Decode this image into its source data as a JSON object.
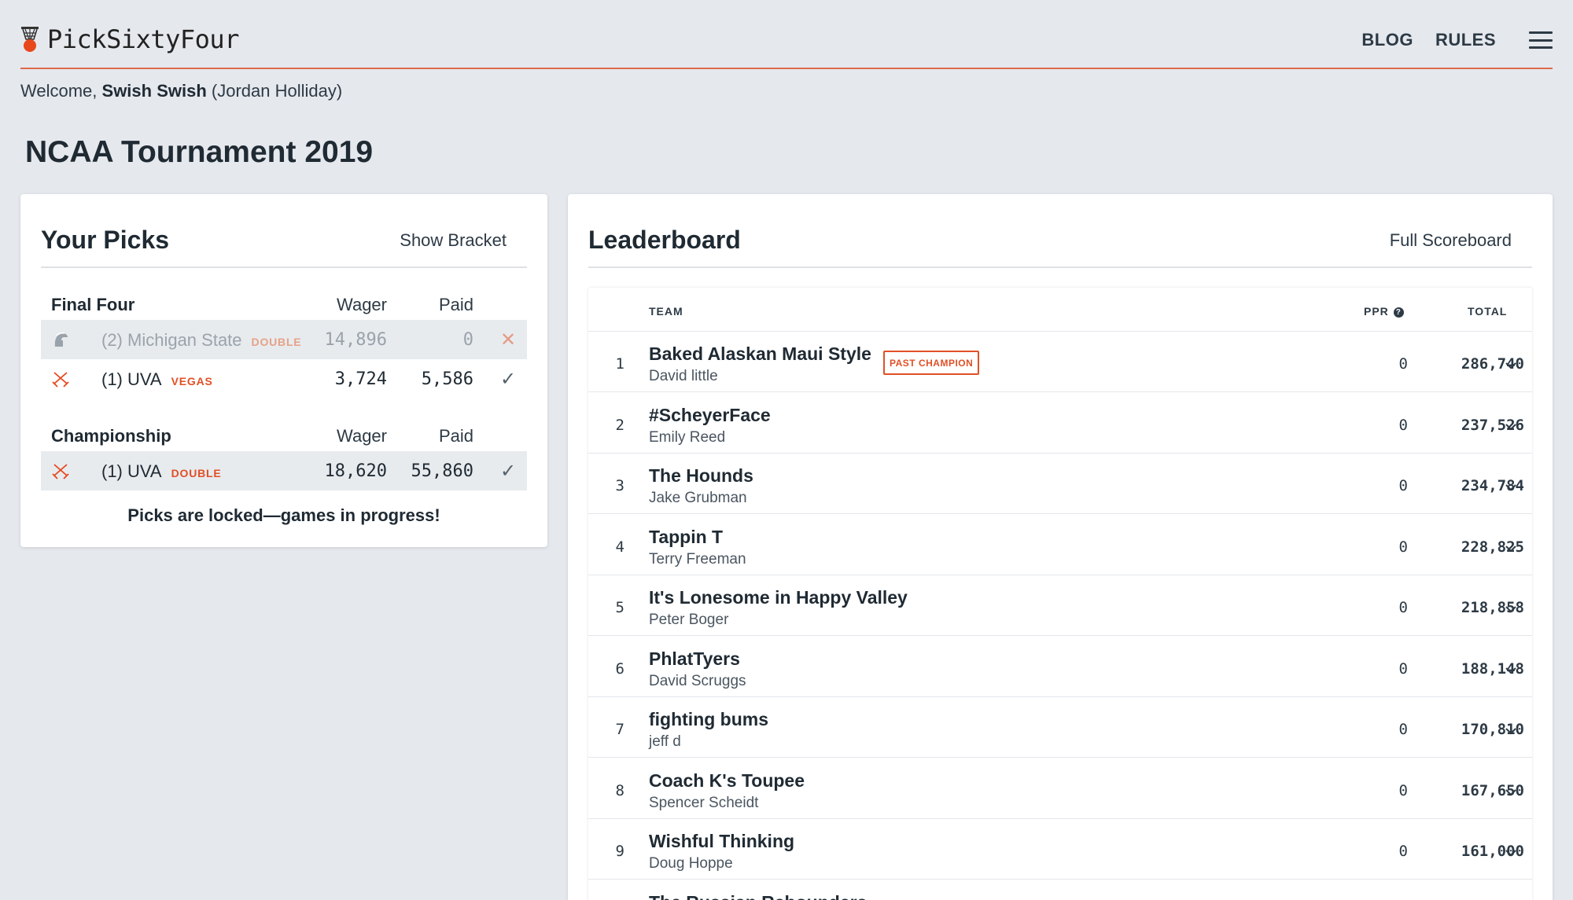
{
  "app": {
    "name": "PickSixtyFour",
    "icon": "basketball-hoop-icon",
    "accent_color": "#e06a49"
  },
  "nav": {
    "blog": "BLOG",
    "rules": "RULES",
    "menu_icon": "hamburger-menu-icon"
  },
  "welcome": {
    "prefix": "Welcome, ",
    "username": "Swish Swish",
    "realname": "(Jordan Holliday)"
  },
  "page": {
    "title": "NCAA Tournament 2019"
  },
  "picks": {
    "title": "Your Picks",
    "action": "Show Bracket",
    "final_four": {
      "label": "Final Four",
      "wager_header": "Wager",
      "paid_header": "Paid",
      "rows": [
        {
          "team": "(2) Michigan State",
          "tag": "DOUBLE",
          "wager": "14,896",
          "paid": "0",
          "status": "✕",
          "icon": "spartan-helmet-icon"
        },
        {
          "team": "(1) UVA",
          "tag": "VEGAS",
          "wager": "3,724",
          "paid": "5,586",
          "status": "✓",
          "icon": "crossed-swords-icon"
        }
      ]
    },
    "championship": {
      "label": "Championship",
      "wager_header": "Wager",
      "paid_header": "Paid",
      "rows": [
        {
          "team": "(1) UVA",
          "tag": "DOUBLE",
          "wager": "18,620",
          "paid": "55,860",
          "status": "✓",
          "icon": "crossed-swords-icon"
        }
      ]
    },
    "locked_message": "Picks are locked—games in progress!"
  },
  "leaderboard": {
    "title": "Leaderboard",
    "action": "Full Scoreboard",
    "headers": {
      "team": "TEAM",
      "ppr": "PPR",
      "help": "?",
      "total": "TOTAL"
    },
    "rows": [
      {
        "rank": "1",
        "name": "Baked Alaskan Maui Style",
        "owner": "David little",
        "badge": "PAST CHAMPION",
        "ppr": "0",
        "total": "286,740"
      },
      {
        "rank": "2",
        "name": "#ScheyerFace",
        "owner": "Emily Reed",
        "badge": "",
        "ppr": "0",
        "total": "237,526"
      },
      {
        "rank": "3",
        "name": "The Hounds",
        "owner": "Jake Grubman",
        "badge": "",
        "ppr": "0",
        "total": "234,784"
      },
      {
        "rank": "4",
        "name": "Tappin T",
        "owner": "Terry Freeman",
        "badge": "",
        "ppr": "0",
        "total": "228,825"
      },
      {
        "rank": "5",
        "name": "It's Lonesome in Happy Valley",
        "owner": "Peter Boger",
        "badge": "",
        "ppr": "0",
        "total": "218,858"
      },
      {
        "rank": "6",
        "name": "PhlatTyers",
        "owner": "David Scruggs",
        "badge": "",
        "ppr": "0",
        "total": "188,148"
      },
      {
        "rank": "7",
        "name": "fighting bums",
        "owner": "jeff d",
        "badge": "",
        "ppr": "0",
        "total": "170,810"
      },
      {
        "rank": "8",
        "name": "Coach K's Toupee",
        "owner": "Spencer Scheidt",
        "badge": "",
        "ppr": "0",
        "total": "167,650"
      },
      {
        "rank": "9",
        "name": "Wishful Thinking",
        "owner": "Doug Hoppe",
        "badge": "",
        "ppr": "0",
        "total": "161,000"
      },
      {
        "rank": "",
        "name": "The Russian Rebounders",
        "owner": "",
        "badge": "",
        "ppr": "",
        "total": ""
      }
    ]
  }
}
